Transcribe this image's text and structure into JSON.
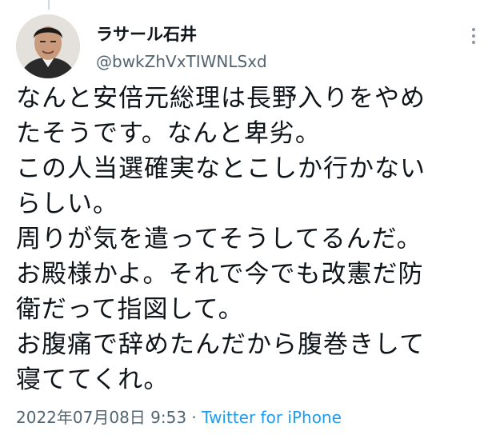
{
  "tweet": {
    "display_name": "ラサール石井",
    "handle": "@bwkZhVxTIWNLSxd",
    "more_icon": "more-dots-icon",
    "lines": [
      "なんと安倍元総理は長野入りをやめ",
      "たそうです。なんと卑劣。",
      "この人当選確実なとこしか行かない",
      "らしい。",
      "周りが気を遣ってそうしてるんだ。",
      "お殿様かよ。それで今でも改憲だ防",
      "衛だって指図して。",
      "お腹痛で辞めたんだから腹巻きして",
      "寝ててくれ。"
    ],
    "timestamp": "2022年07月08日 9:53",
    "separator": " · ",
    "source": "Twitter for iPhone"
  },
  "colors": {
    "text": "#0f1419",
    "secondary": "#536471",
    "link": "#1d9bf0"
  }
}
